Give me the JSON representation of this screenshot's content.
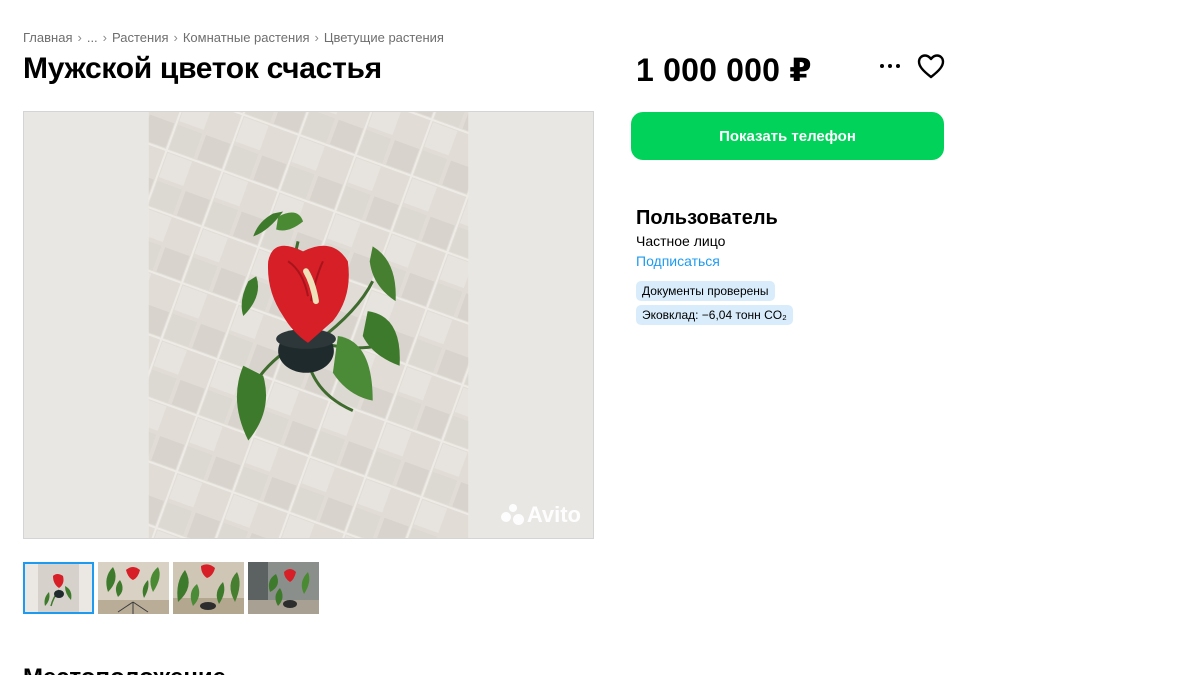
{
  "breadcrumb": {
    "items": [
      "Главная",
      "...",
      "Растения",
      "Комнатные растения",
      "Цветущие растения"
    ],
    "separator": "›"
  },
  "listing": {
    "title": "Мужской цветок счастья",
    "price": "1 000 000 ₽"
  },
  "gallery": {
    "watermark": "Avito",
    "thumbnail_count": 4,
    "active_thumbnail": 1
  },
  "actions": {
    "show_phone_label": "Показать телефон"
  },
  "seller": {
    "name": "Пользователь",
    "type": "Частное лицо",
    "subscribe_label": "Подписаться",
    "badges": {
      "docs": "Документы проверены",
      "eco": "Эковклад: −6,04 тонн CO₂"
    }
  },
  "section": {
    "next_heading": "Местоположение"
  },
  "colors": {
    "accent_green": "#00d25a",
    "link_blue": "#1e9bf0",
    "badge_bg": "#d9ecfb"
  },
  "icons": [
    "more-dots-icon",
    "heart-icon",
    "avito-logo-icon"
  ]
}
